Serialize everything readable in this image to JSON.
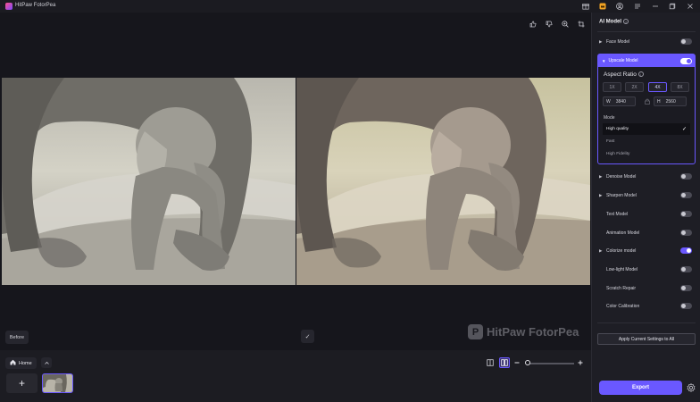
{
  "titlebar": {
    "title": "HitPaw FotorPea"
  },
  "canvas": {
    "before_label": "Before",
    "check_symbol": "✓",
    "watermark": "HitPaw FotorPea"
  },
  "bottom": {
    "home_label": "Home",
    "add_symbol": "+"
  },
  "panel": {
    "title": "AI Model",
    "info": "i",
    "face_model": "Face Model",
    "upscale_model": "Upscale Model",
    "aspect_ratio": "Aspect Ratio",
    "scales": [
      "1X",
      "2X",
      "4X",
      "8X"
    ],
    "width_label": "W",
    "width_value": "3840",
    "height_label": "H",
    "height_value": "2560",
    "mode_label": "Mode",
    "modes": [
      "High quality",
      "Fast",
      "High Fidelity"
    ],
    "denoise_model": "Denoise Model",
    "sharpen_model": "Sharpen Model",
    "text_model": "Text Model",
    "animation_model": "Animation Model",
    "colorize_model": "Colorize model",
    "lowlight_model": "Low-light Model",
    "scratch_repair": "Scratch Repair",
    "color_calibration": "Color Calibration",
    "apply_all": "Apply Current Settings to All",
    "export": "Export"
  },
  "state": {
    "face_model_on": false,
    "upscale_model_on": true,
    "selected_scale": "4X",
    "selected_mode": "High quality",
    "denoise_on": false,
    "sharpen_on": false,
    "text_on": false,
    "animation_on": false,
    "colorize_on": true,
    "lowlight_on": false,
    "scratch_on": false,
    "calibration_on": false
  },
  "icons": {
    "app": "hitpaw-logo-icon",
    "gift": "gift-icon",
    "crown": "premium-icon",
    "account": "account-icon",
    "menu": "menu-icon",
    "minimize": "minimize-icon",
    "maximize": "maximize-icon",
    "close": "close-icon"
  },
  "colors": {
    "accent": "#6a58ff",
    "background": "#16161c",
    "panel": "#1e1e25"
  }
}
